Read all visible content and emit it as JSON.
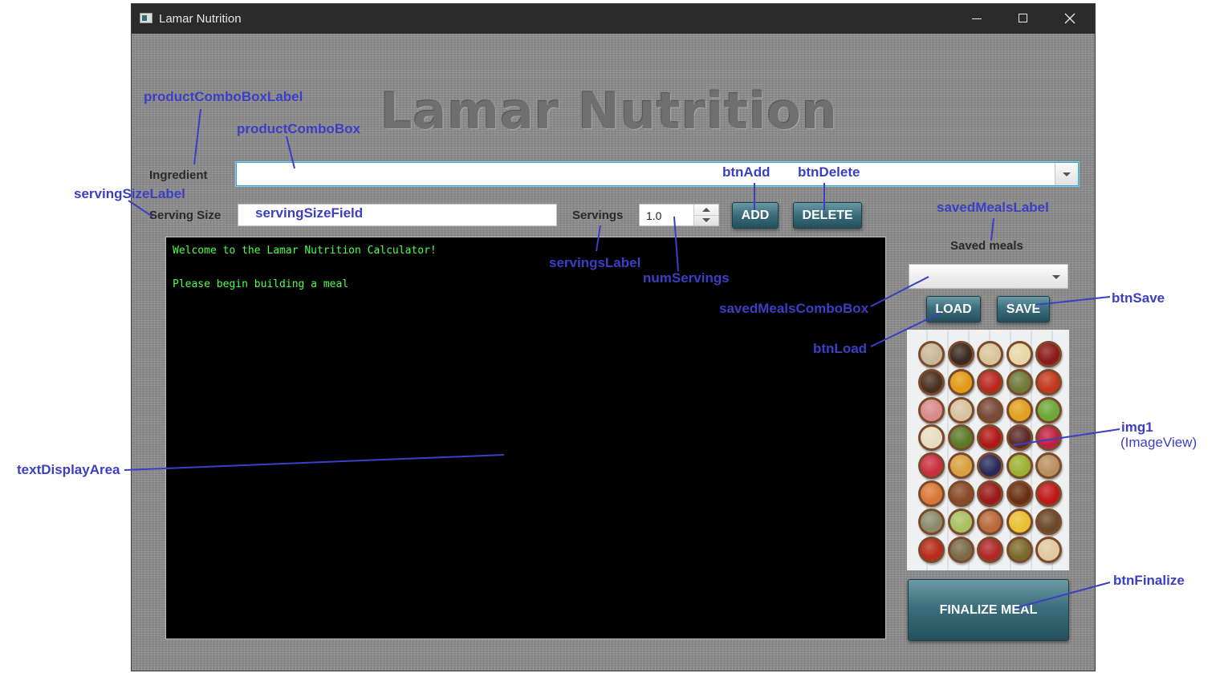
{
  "window": {
    "title": "Lamar Nutrition",
    "controls": [
      "minimize",
      "maximize",
      "close"
    ]
  },
  "header": {
    "title": "Lamar Nutrition"
  },
  "form": {
    "ingredient_label": "Ingredient",
    "ingredient_value": "",
    "serving_size_label": "Serving Size",
    "serving_size_value": "",
    "servings_label": "Servings",
    "servings_value": "1.0",
    "add_label": "ADD",
    "delete_label": "DELETE"
  },
  "display": {
    "text": "Welcome to the Lamar Nutrition Calculator!\n\nPlease begin building a meal"
  },
  "saved": {
    "label": "Saved meals",
    "selected": "",
    "load_label": "LOAD",
    "save_label": "SAVE",
    "finalize_label": "FINALIZE MEAL"
  },
  "image": {
    "description_icon": "food-bowls-image"
  },
  "annotations": {
    "productComboBoxLabel": "productComboBoxLabel",
    "productComboBox": "productComboBox",
    "servingSizeLabel": "servingSizeLabel",
    "servingSizeField": "servingSizeField",
    "btnAdd": "btnAdd",
    "btnDelete": "btnDelete",
    "savedMealsLabel": "savedMealsLabel",
    "servingsLabel": "servingsLabel",
    "numServings": "numServings",
    "savedMealsComboBox": "savedMealsComboBox",
    "btnSave": "btnSave",
    "btnLoad": "btnLoad",
    "img1": "img1",
    "img1_type": "(ImageView)",
    "textDisplayArea": "textDisplayArea",
    "btnFinalize": "btnFinalize"
  },
  "colors": {
    "annotation": "#3b3fc4",
    "console_text": "#4cff4c",
    "button_teal": "#3d6f7c",
    "background": "#909090"
  }
}
